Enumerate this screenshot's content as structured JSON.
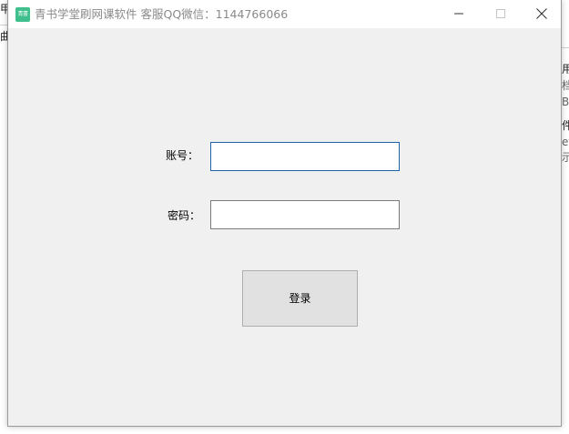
{
  "background_app": {
    "fragments": [
      "甲",
      "曲",
      "用",
      "档",
      "B",
      "件",
      "et",
      "示"
    ]
  },
  "window": {
    "icon_text": "青書",
    "title": "青书学堂刷网课软件 客服QQ微信：1144766066",
    "controls": {
      "minimize_icon": "minimize-icon",
      "maximize_icon": "maximize-icon",
      "close_icon": "close-icon"
    }
  },
  "form": {
    "account_label": "账号：",
    "account_value": "",
    "password_label": "密码：",
    "password_value": "",
    "login_label": "登录"
  },
  "colors": {
    "window_bg": "#f0f0f0",
    "titlebar_bg": "#ffffff",
    "focus_border": "#1e62a8",
    "app_icon": "#3fbf8c"
  }
}
